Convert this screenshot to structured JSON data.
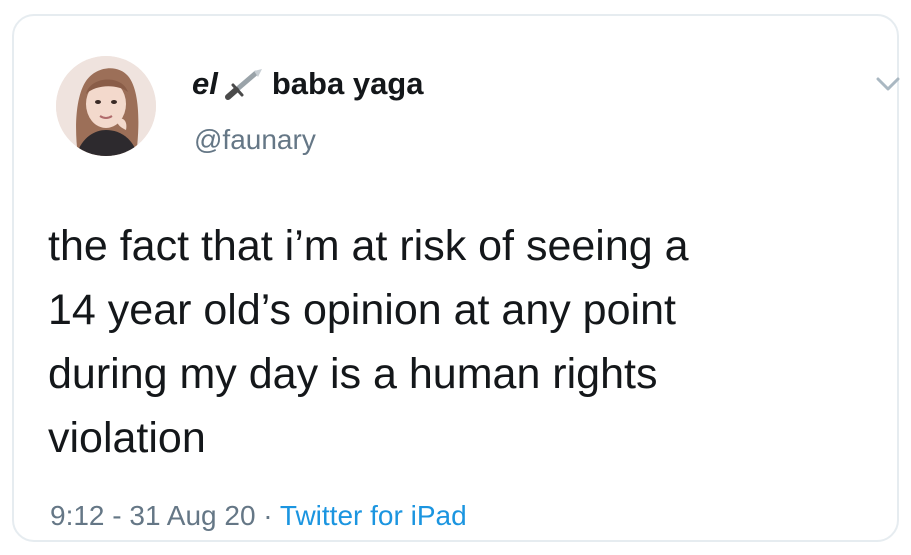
{
  "tweet": {
    "author": {
      "name_prefix": "el",
      "name_main": "baba yaga",
      "handle": "@faunary",
      "name_emoji_icon": "dagger-icon"
    },
    "text_lines": [
      "the fact that i’m at risk of seeing a",
      "14 year old’s opinion at any point",
      "during my day is a human rights",
      "violation"
    ],
    "time": "9:12",
    "date": "31 Aug 20",
    "separator": " · ",
    "dash": " - ",
    "source": "Twitter for iPad"
  },
  "colors": {
    "text": "#14171a",
    "secondary": "#657786",
    "link": "#1b95e0",
    "border": "#e6ecf0"
  },
  "icons": {
    "menu": "chevron-down-icon",
    "avatar": "avatar"
  }
}
